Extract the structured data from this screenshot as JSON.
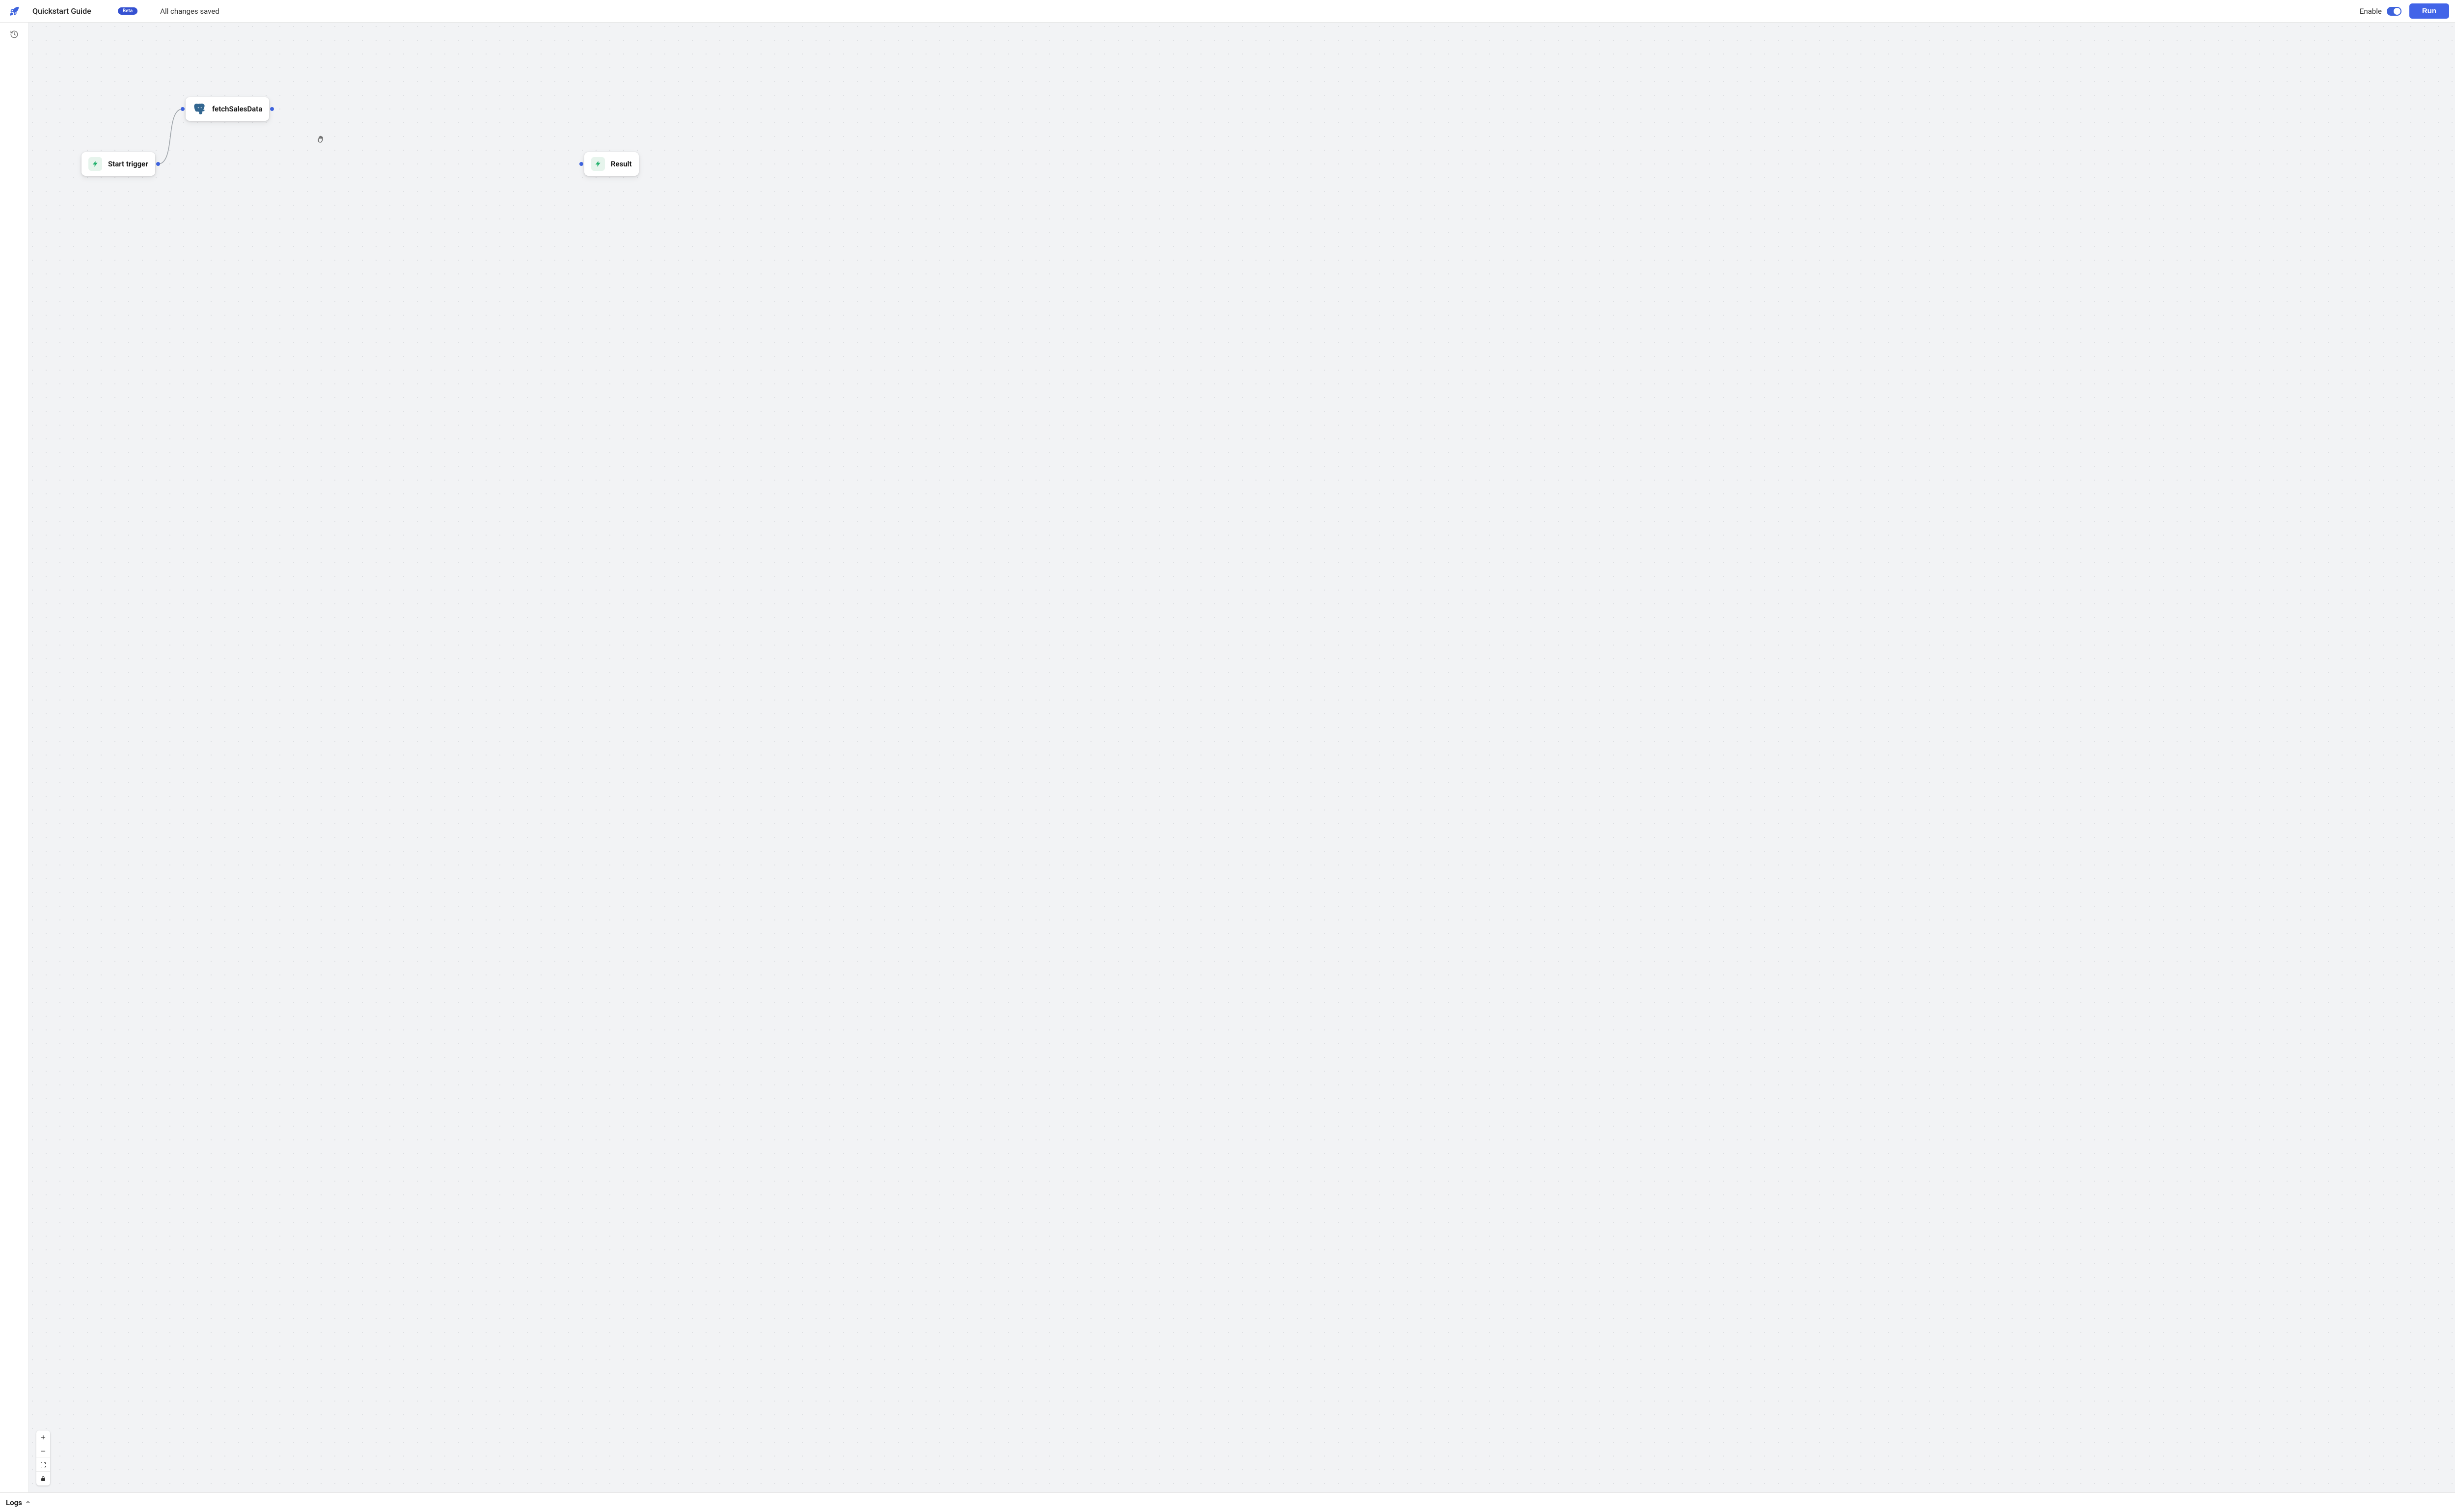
{
  "header": {
    "title": "Quickstart Guide",
    "badge": "Beta",
    "status": "All changes saved",
    "enable_label": "Enable",
    "enable_on": true,
    "run_label": "Run"
  },
  "canvas": {
    "nodes": {
      "start": {
        "label": "Start trigger",
        "icon": "bolt-icon"
      },
      "fetch": {
        "label": "fetchSalesData",
        "icon": "postgres-icon"
      },
      "result": {
        "label": "Result",
        "icon": "bolt-icon"
      }
    }
  },
  "zoom": {
    "in_icon": "plus-icon",
    "out_icon": "minus-icon",
    "fit_icon": "fit-screen-icon",
    "lock_icon": "lock-icon"
  },
  "logs": {
    "label": "Logs"
  }
}
